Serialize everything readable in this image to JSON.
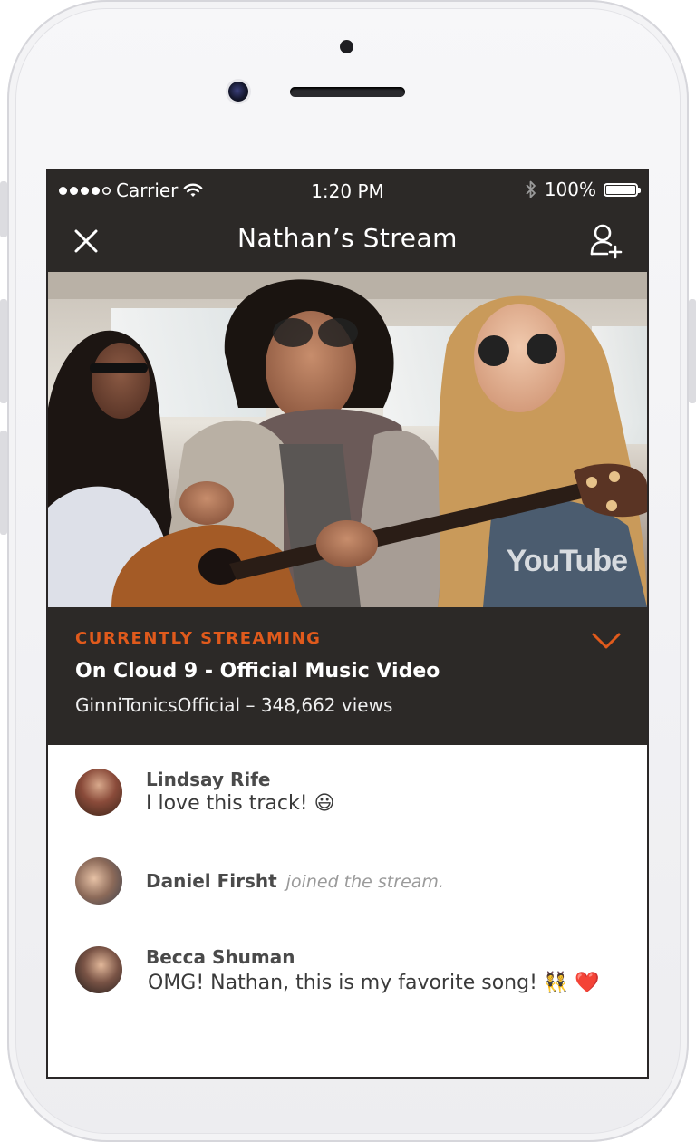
{
  "status_bar": {
    "carrier": "Carrier",
    "time": "1:20 PM",
    "battery": "100%"
  },
  "nav": {
    "title": "Nathan’s Stream"
  },
  "video": {
    "watermark": "YouTube"
  },
  "now_playing": {
    "kicker": "CURRENTLY STREAMING",
    "song": "On Cloud 9 - Official Music Video",
    "meta": "GinniTonicsOfficial – 348,662 views"
  },
  "feed": {
    "comments": [
      {
        "name": "Lindsay Rife",
        "text": "I love this track! 😃"
      },
      {
        "name": "Daniel Firsht",
        "action": "joined the stream."
      },
      {
        "name": "Becca Shuman",
        "text": "OMG! Nathan, this is my favorite song! 👯 ❤️"
      }
    ]
  },
  "colors": {
    "accent": "#e05a1c",
    "bar": "#2c2927"
  }
}
